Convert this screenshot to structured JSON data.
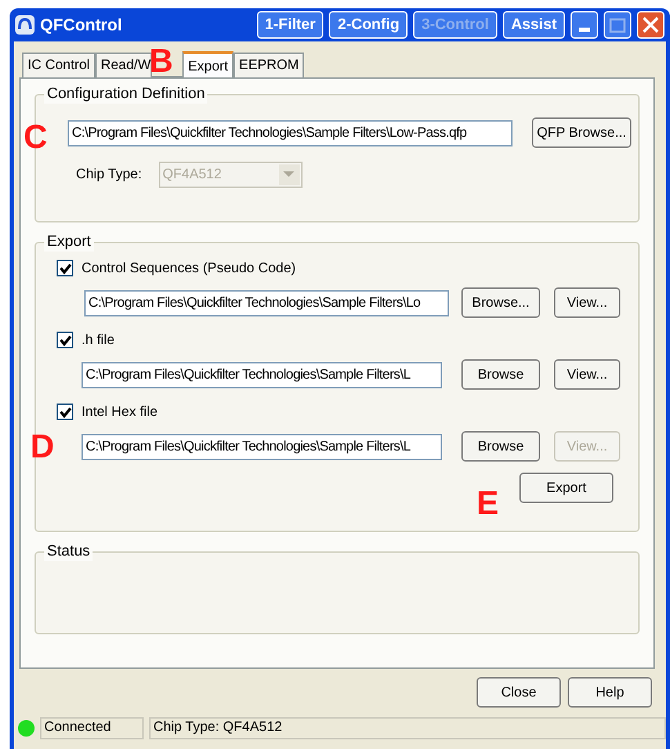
{
  "window": {
    "title": "QFControl",
    "nav_buttons": [
      {
        "label": "1-Filter",
        "disabled": false
      },
      {
        "label": "2-Config",
        "disabled": false
      },
      {
        "label": "3-Control",
        "disabled": true
      },
      {
        "label": "Assist",
        "disabled": false
      }
    ]
  },
  "tabs": [
    {
      "label": "IC Control",
      "selected": false
    },
    {
      "label": "Read/W",
      "selected": false
    },
    {
      "label": "Export",
      "selected": true
    },
    {
      "label": "EEPROM",
      "selected": false
    }
  ],
  "config": {
    "title": "Configuration Definition",
    "path": "C:\\Program Files\\Quickfilter Technologies\\Sample Filters\\Low-Pass.qfp",
    "browse_button": "QFP Browse...",
    "chip_type_label": "Chip Type:",
    "chip_type": "QF4A512",
    "chip_type_disabled": true
  },
  "export": {
    "title": "Export",
    "items": [
      {
        "label": "Control Sequences (Pseudo Code)",
        "checked": true,
        "path": "C:\\Program Files\\Quickfilter Technologies\\Sample Filters\\Lo",
        "browse": "Browse...",
        "view": "View...",
        "view_disabled": false
      },
      {
        "label": ".h file",
        "checked": true,
        "path": "C:\\Program Files\\Quickfilter Technologies\\Sample Filters\\L",
        "browse": "Browse",
        "view": "View...",
        "view_disabled": false
      },
      {
        "label": "Intel Hex file",
        "checked": true,
        "path": "C:\\Program Files\\Quickfilter Technologies\\Sample Filters\\L",
        "browse": "Browse",
        "view": "View...",
        "view_disabled": true
      }
    ],
    "export_button": "Export"
  },
  "status": {
    "title": "Status"
  },
  "buttons": [
    "Close",
    "Help"
  ],
  "status_bar": {
    "connected": true,
    "connection": "Connected",
    "chip_type": "Chip Type: QF4A512"
  },
  "annotations": [
    "B",
    "C",
    "D",
    "E"
  ]
}
